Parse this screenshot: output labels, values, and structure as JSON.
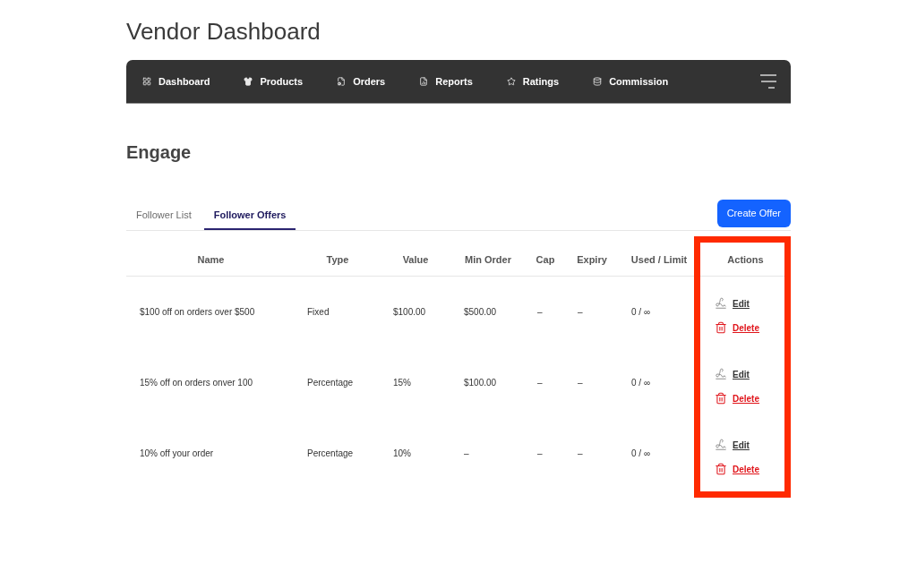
{
  "page_title": "Vendor Dashboard",
  "nav": {
    "items": [
      "Dashboard",
      "Products",
      "Orders",
      "Reports",
      "Ratings",
      "Commission"
    ]
  },
  "section_title": "Engage",
  "tabs": [
    {
      "label": "Follower List",
      "selected": false
    },
    {
      "label": "Follower Offers",
      "selected": true
    }
  ],
  "create_button": {
    "label": "Create Offer"
  },
  "table": {
    "columns": [
      {
        "label": "Name",
        "highlighted": false
      },
      {
        "label": "Type",
        "highlighted": false
      },
      {
        "label": "Value",
        "highlighted": false
      },
      {
        "label": "Min Order",
        "highlighted": false
      },
      {
        "label": "Cap",
        "highlighted": false
      },
      {
        "label": "Expiry",
        "highlighted": false
      },
      {
        "label": "Used / Limit",
        "highlighted": false
      },
      {
        "label": "Actions",
        "highlighted": true
      }
    ],
    "rows": [
      {
        "cells": [
          "$100 off on orders over $500",
          "Fixed",
          "$100.00",
          "$500.00",
          "–",
          "–",
          "0 / ∞"
        ],
        "actions": [
          {
            "kind": "edit",
            "label": "Edit"
          },
          {
            "kind": "delete",
            "label": "Delete"
          }
        ]
      },
      {
        "cells": [
          "15% off on orders onver 100",
          "Percentage",
          "15%",
          "$100.00",
          "–",
          "–",
          "0 / ∞"
        ],
        "actions": [
          {
            "kind": "edit",
            "label": "Edit"
          },
          {
            "kind": "delete",
            "label": "Delete"
          }
        ]
      },
      {
        "cells": [
          "10% off your order",
          "Percentage",
          "10%",
          "–",
          "–",
          "–",
          "0 / ∞"
        ],
        "actions": [
          {
            "kind": "edit",
            "label": "Edit"
          },
          {
            "kind": "delete",
            "label": "Delete"
          }
        ]
      }
    ]
  }
}
